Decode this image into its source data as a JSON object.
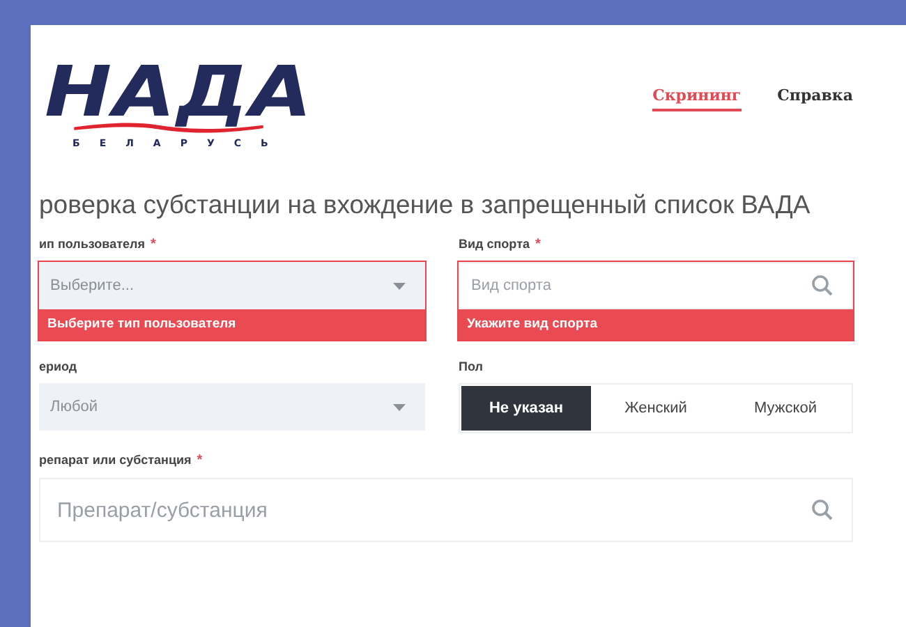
{
  "logo": {
    "text": "НАДА",
    "subtitle": "БЕЛАРУСЬ"
  },
  "nav": [
    {
      "label": "Скрининг",
      "selected": true
    },
    {
      "label": "Справка",
      "selected": false
    }
  ],
  "title": "роверка субстанции на вхождение в запрещенный список ВАДА",
  "fields": [
    {
      "kind": "select",
      "label": "ип пользователя",
      "required_mark": "*",
      "value": "Выберите...",
      "invalid": true,
      "error": "Выберите тип пользователя"
    },
    {
      "kind": "search",
      "label": "Вид спорта",
      "required_mark": "*",
      "placeholder": "Вид спорта",
      "invalid": true,
      "error": "Укажите вид спорта"
    },
    {
      "kind": "select",
      "label": "ериод",
      "value": "Любой",
      "invalid": false
    },
    {
      "kind": "segmented",
      "label": "Пол",
      "options": [
        {
          "label": "Не указан",
          "selected": true
        },
        {
          "label": "Женский",
          "selected": false
        },
        {
          "label": "Мужской",
          "selected": false
        }
      ]
    },
    {
      "kind": "search",
      "label": "репарат или субстанция",
      "required_mark": "*",
      "placeholder": "Препарат/субстанция",
      "invalid": false,
      "wide": true
    }
  ]
}
